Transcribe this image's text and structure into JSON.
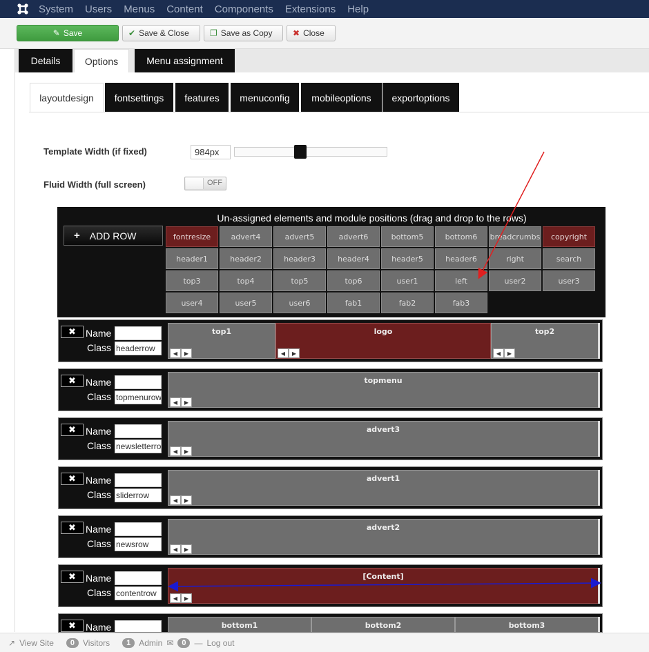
{
  "topnav": {
    "items": [
      "System",
      "Users",
      "Menus",
      "Content",
      "Components",
      "Extensions",
      "Help"
    ]
  },
  "toolbar": {
    "save": "Save",
    "save_close": "Save & Close",
    "save_copy": "Save as Copy",
    "close": "Close"
  },
  "main_tabs": [
    "Details",
    "Options",
    "Menu assignment"
  ],
  "sub_tabs": [
    "layoutdesign",
    "fontsettings",
    "features",
    "menuconfig",
    "mobileoptions",
    "exportoptions"
  ],
  "settings": {
    "template_width_label": "Template Width (if fixed)",
    "template_width_value": "984px",
    "fluid_width_label": "Fluid Width (full screen)",
    "fluid_toggle": "OFF"
  },
  "unassigned": {
    "title": "Un-assigned elements and module positions (drag and drop to the rows)",
    "add_row": "ADD ROW",
    "chips": [
      "fontresize",
      "advert4",
      "advert5",
      "advert6",
      "bottom5",
      "bottom6",
      "breadcrumbs",
      "copyright",
      "header1",
      "header2",
      "header3",
      "header4",
      "header5",
      "header6",
      "right",
      "search",
      "top3",
      "top4",
      "top5",
      "top6",
      "user1",
      "left",
      "user2",
      "user3",
      "user4",
      "user5",
      "user6",
      "fab1",
      "fab2",
      "fab3"
    ],
    "red_chips": [
      "fontresize",
      "copyright"
    ]
  },
  "row_labels": {
    "name": "Name",
    "class": "Class"
  },
  "rows": [
    {
      "class": "headerrow",
      "cells": [
        "top1",
        "logo",
        "top2"
      ]
    },
    {
      "class": "topmenurow",
      "cells": [
        "topmenu"
      ]
    },
    {
      "class": "newsletterrow",
      "cells": [
        "advert3"
      ]
    },
    {
      "class": "sliderrow",
      "cells": [
        "advert1"
      ]
    },
    {
      "class": "newsrow",
      "cells": [
        "advert2"
      ]
    },
    {
      "class": "contentrow",
      "cells": [
        "[Content]"
      ]
    },
    {
      "class": "",
      "cells": [
        "bottom1",
        "bottom2",
        "bottom3"
      ]
    }
  ],
  "status": {
    "view_site": "View Site",
    "visitors_count": "0",
    "visitors": "Visitors",
    "admin_count": "1",
    "admin": "Admin",
    "msg_count": "0",
    "logout": "Log out"
  },
  "colors": {
    "nav_bg": "#1b2d50",
    "save_green": "#5cb85c",
    "module_red": "#6c1e1e",
    "module_grey": "#6e6e6e",
    "annotation_red": "#e02020",
    "annotation_blue": "#1a1ad0"
  }
}
